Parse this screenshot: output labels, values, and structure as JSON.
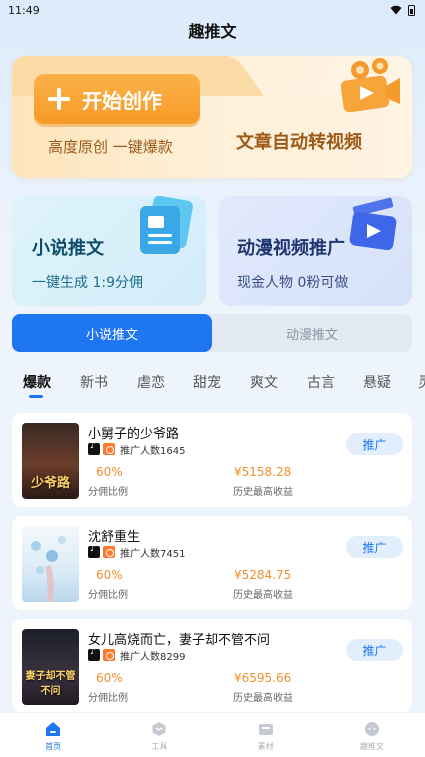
{
  "status_bar": {
    "time": "11:49"
  },
  "app_title": "趣推文",
  "banner": {
    "button_label": "开始创作",
    "subtitle": "高度原创 一键爆款",
    "headline": "文章自动转视频"
  },
  "cards": [
    {
      "title": "小说推文",
      "subtitle": "一键生成 1:9分佣"
    },
    {
      "title": "动漫视频推广",
      "subtitle": "现金人物 0粉可做"
    }
  ],
  "segment": {
    "tabs": [
      "小说推文",
      "动漫推文"
    ],
    "active": 0
  },
  "categories": [
    "爆款",
    "新书",
    "虐恋",
    "甜宠",
    "爽文",
    "古言",
    "悬疑",
    "灵"
  ],
  "list": [
    {
      "title": "小舅子的少爷路",
      "cover_text": "少爷路",
      "promo": "推广人数1645",
      "rate": "60%",
      "rate_label": "分佣比例",
      "income": "¥5158.28",
      "income_label": "历史最高收益",
      "button": "推广"
    },
    {
      "title": "沈舒重生",
      "cover_text": "",
      "promo": "推广人数7451",
      "rate": "60%",
      "rate_label": "分佣比例",
      "income": "¥5284.75",
      "income_label": "历史最高收益",
      "button": "推广"
    },
    {
      "title": "女儿高烧而亡，妻子却不管不问",
      "cover_text": "妻子却不管不问",
      "promo": "推广人数8299",
      "rate": "60%",
      "rate_label": "分佣比例",
      "income": "¥6595.66",
      "income_label": "历史最高收益",
      "button": "推广"
    }
  ],
  "nav": [
    {
      "label": "首页",
      "icon": "home-icon",
      "active": true
    },
    {
      "label": "工具",
      "icon": "tool-icon",
      "active": false
    },
    {
      "label": "素材",
      "icon": "folder-icon",
      "active": false
    },
    {
      "label": "趣推文",
      "icon": "chat-icon",
      "active": false
    }
  ],
  "colors": {
    "accent": "#1e76f2",
    "orange": "#f79a26",
    "income": "#f0902d"
  }
}
